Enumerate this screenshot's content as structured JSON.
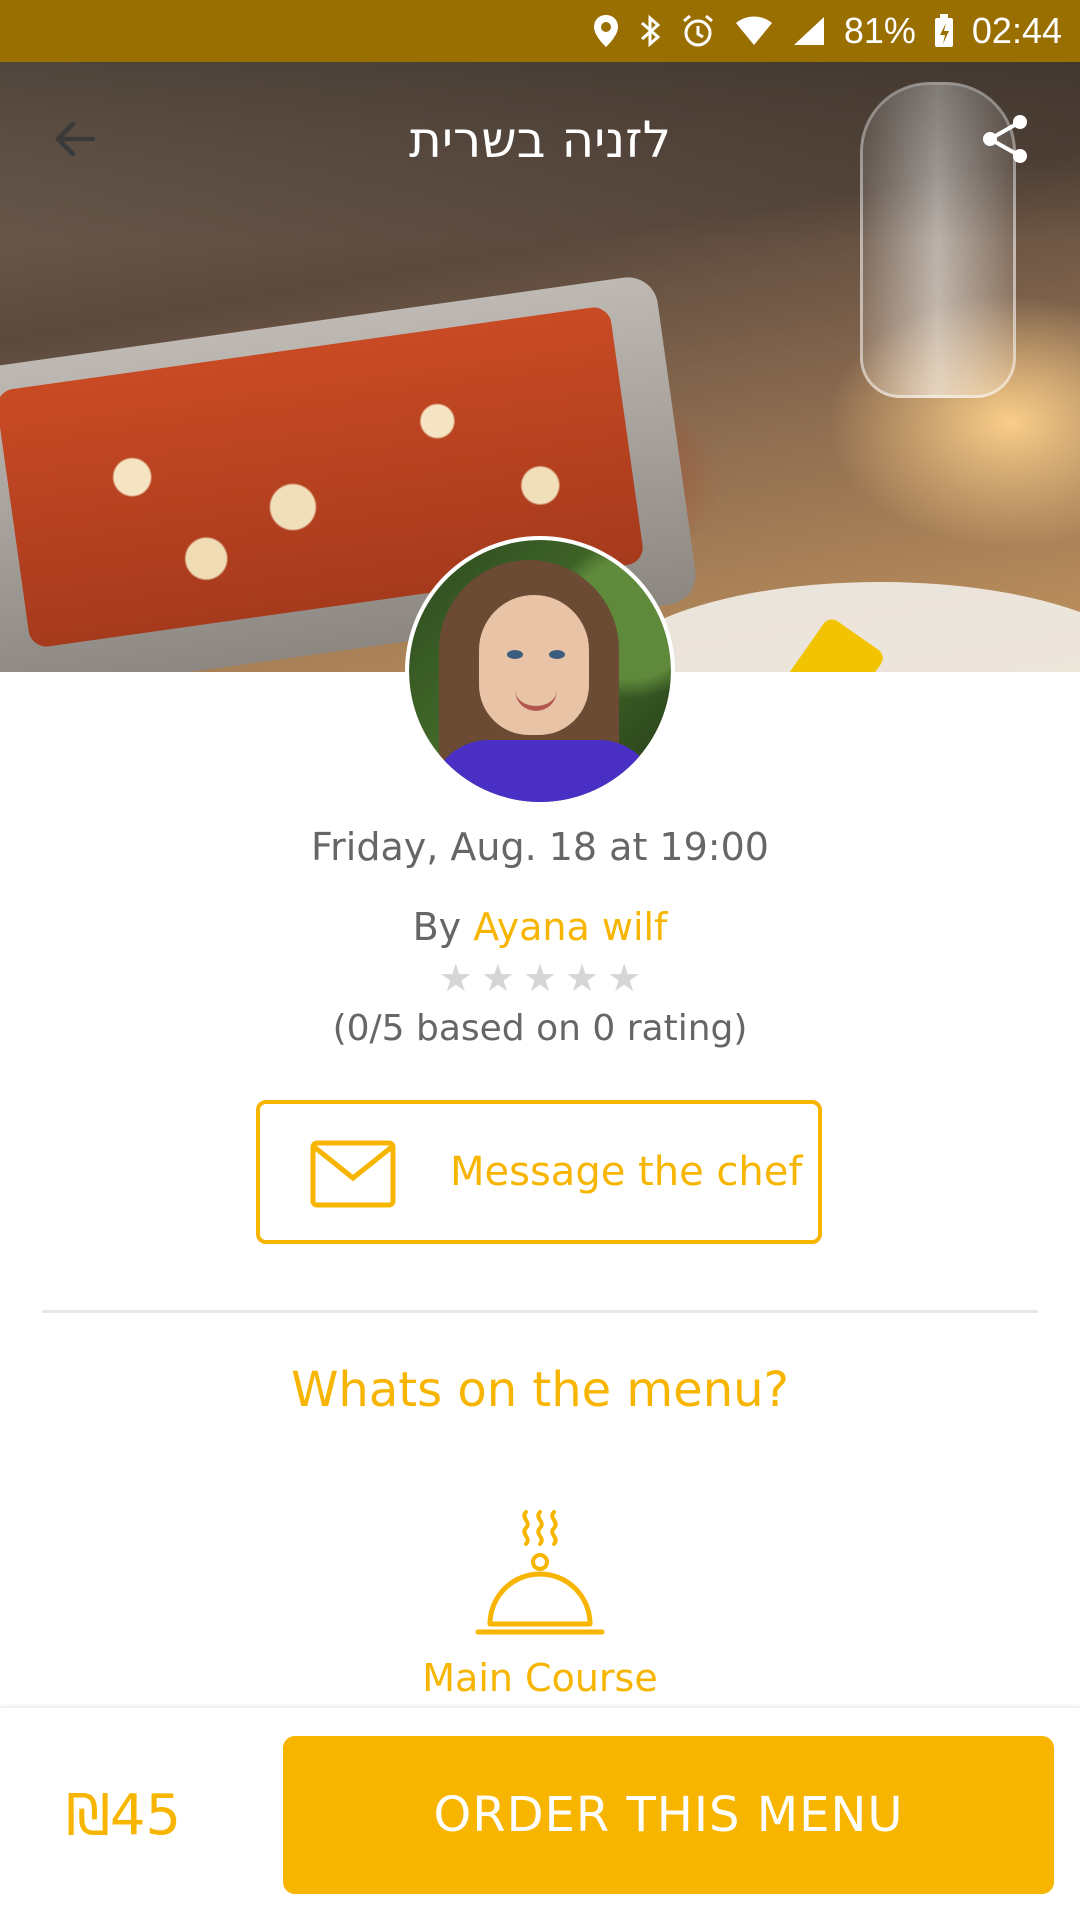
{
  "status_bar": {
    "battery": "81%",
    "time": "02:44",
    "icons": [
      "location-icon",
      "bluetooth-icon",
      "alarm-icon",
      "wifi-icon",
      "signal-icon",
      "battery-icon"
    ]
  },
  "header": {
    "title": "לזניה בשרית",
    "back_icon": "arrow-left-icon",
    "share_icon": "share-icon"
  },
  "event": {
    "date": "Friday, Aug. 18 at 19:00",
    "by_prefix": "By",
    "chef_name": "Ayana wilf",
    "rating_value": 0,
    "rating_max": 5,
    "rating_text": "(0/5 based on 0 rating)"
  },
  "message_button": {
    "label": "Message the chef",
    "icon": "envelope-icon"
  },
  "menu": {
    "heading": "Whats on the menu?",
    "course_label": "Main Course",
    "course_icon": "cloche-icon"
  },
  "order": {
    "price": "₪45",
    "button_label": "ORDER THIS MENU"
  },
  "colors": {
    "accent": "#f7b500",
    "status_bar": "#9a6f02"
  }
}
